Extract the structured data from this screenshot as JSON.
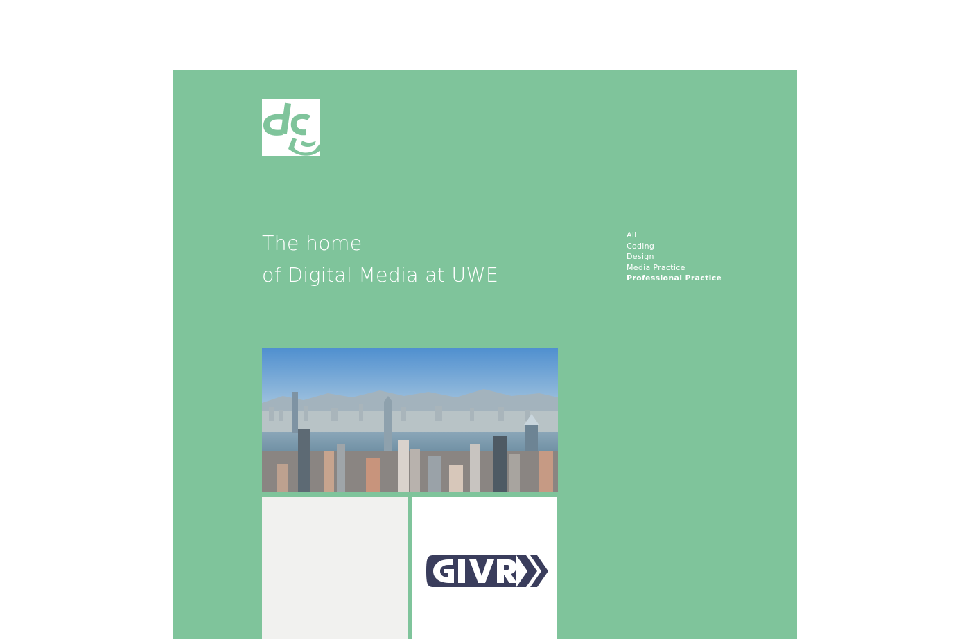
{
  "brand": {
    "logo_icon": "dcu-monogram-logo",
    "bg_color": "#7fc49b",
    "text_color": "#ffffff"
  },
  "hero": {
    "headline_line1": "The home",
    "headline_line2": "of Digital Media at UWE"
  },
  "filters": {
    "items": [
      {
        "label": "All",
        "active": false
      },
      {
        "label": "Coding",
        "active": false
      },
      {
        "label": "Design",
        "active": false
      },
      {
        "label": "Media Practice",
        "active": false
      },
      {
        "label": "Professional Practice",
        "active": true
      }
    ]
  },
  "projects": [
    {
      "image": "city-skyline-photo"
    },
    {
      "image": "blank-placeholder"
    },
    {
      "image": "givr-logo",
      "logo_text": "GIVR",
      "logo_color": "#3a3d5c"
    }
  ]
}
